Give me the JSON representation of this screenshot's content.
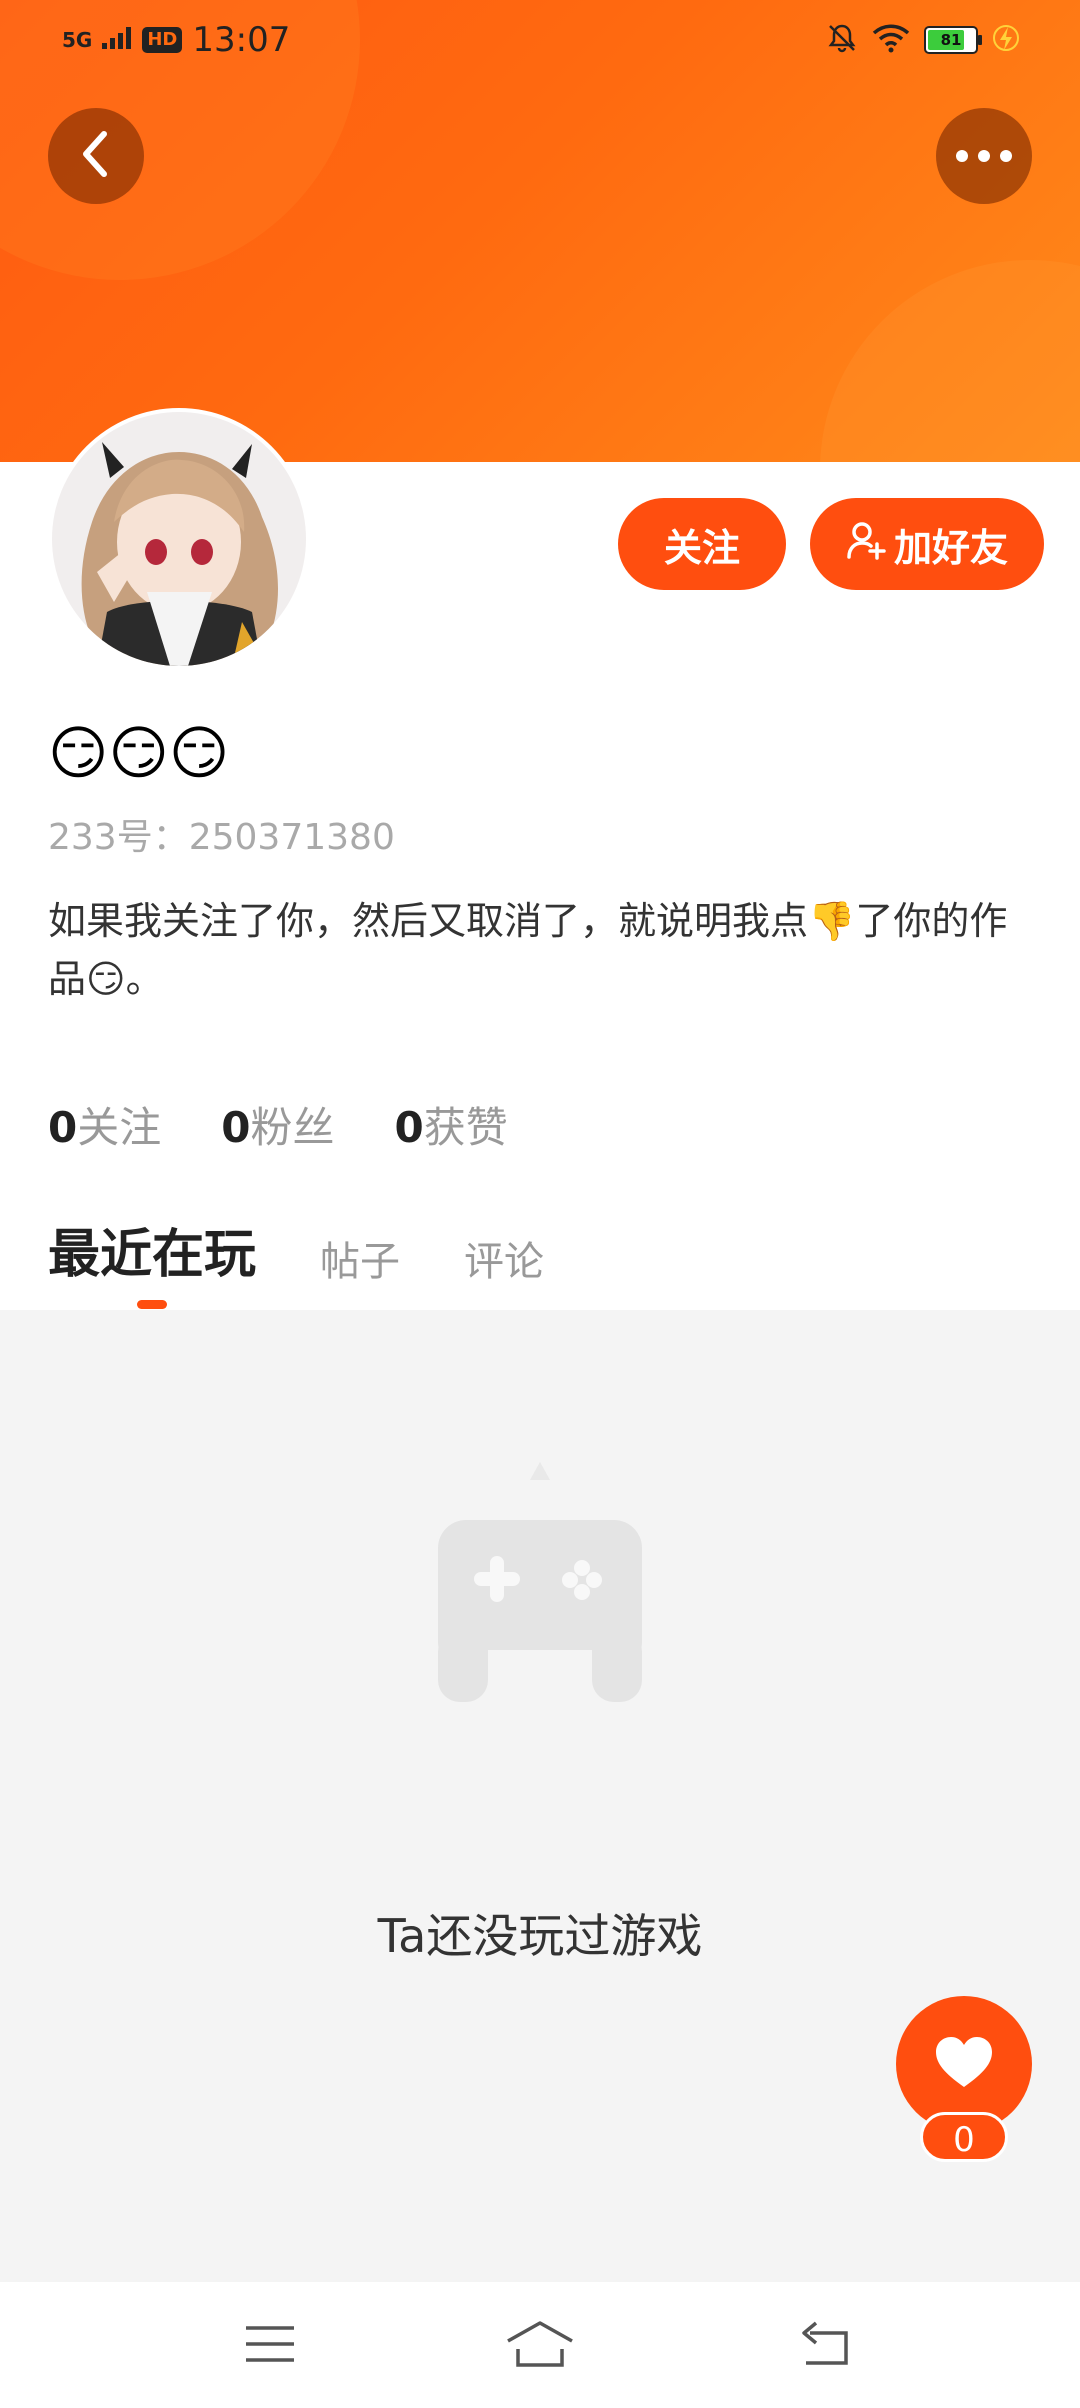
{
  "status_bar": {
    "signal": "5G",
    "hd": "HD",
    "time": "13:07",
    "battery": "81"
  },
  "header": {
    "back_icon": "chevron-left-icon",
    "more_icon": "more-horizontal-icon"
  },
  "profile": {
    "nickname": "😏😏😏",
    "user_id": "233号：250371380",
    "bio": "如果我关注了你，然后又取消了，就说明我点👎了你的作品😏。"
  },
  "actions": {
    "follow_label": "关注",
    "add_friend_label": "加好友"
  },
  "stats": [
    {
      "count": "0",
      "label": "关注"
    },
    {
      "count": "0",
      "label": "粉丝"
    },
    {
      "count": "0",
      "label": "获赞"
    }
  ],
  "tabs": [
    {
      "label": "最近在玩",
      "active": true
    },
    {
      "label": "帖子",
      "active": false
    },
    {
      "label": "评论",
      "active": false
    }
  ],
  "empty_state": {
    "text": "Ta还没玩过游戏",
    "icon": "gamepad-icon"
  },
  "like": {
    "count": "0",
    "icon": "heart-icon"
  },
  "colors": {
    "accent": "#ff4e0f",
    "header_gradient_start": "#ff5a12",
    "header_gradient_end": "#ff8a1a"
  }
}
